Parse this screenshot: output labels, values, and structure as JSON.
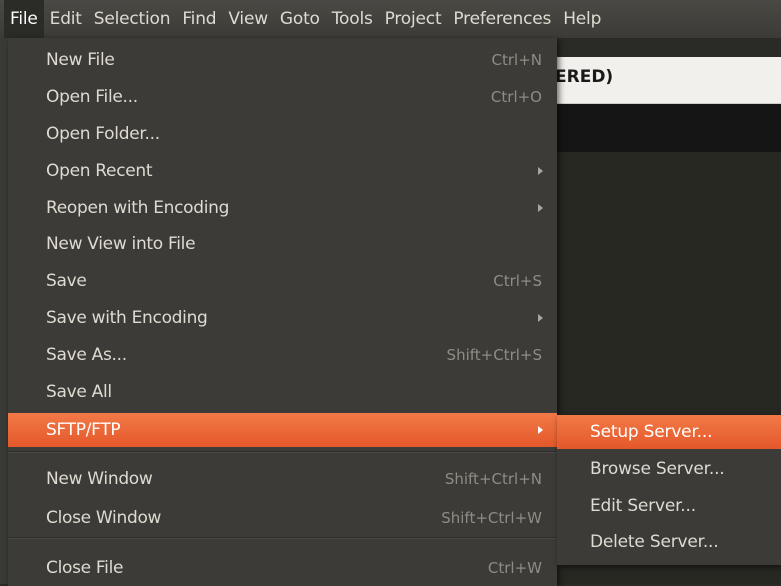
{
  "menubar": {
    "items": [
      "File",
      "Edit",
      "Selection",
      "Find",
      "View",
      "Goto",
      "Tools",
      "Project",
      "Preferences",
      "Help"
    ],
    "active": "File"
  },
  "background": {
    "header_fragment": "ERED)"
  },
  "file_menu": {
    "items": [
      {
        "label": "New File",
        "shortcut": "Ctrl+N"
      },
      {
        "label": "Open File...",
        "shortcut": "Ctrl+O"
      },
      {
        "label": "Open Folder...",
        "shortcut": ""
      },
      {
        "label": "Open Recent",
        "shortcut": "",
        "submenu": true
      },
      {
        "label": "Reopen with Encoding",
        "shortcut": "",
        "submenu": true
      },
      {
        "label": "New View into File",
        "shortcut": ""
      },
      {
        "label": "Save",
        "shortcut": "Ctrl+S"
      },
      {
        "label": "Save with Encoding",
        "shortcut": "",
        "submenu": true
      },
      {
        "label": "Save As...",
        "shortcut": "Shift+Ctrl+S"
      },
      {
        "label": "Save All",
        "shortcut": ""
      },
      {
        "label": "SFTP/FTP",
        "shortcut": "",
        "submenu": true,
        "highlighted": true
      },
      {
        "label": "New Window",
        "shortcut": "Shift+Ctrl+N"
      },
      {
        "label": "Close Window",
        "shortcut": "Shift+Ctrl+W"
      },
      {
        "label": "Close File",
        "shortcut": "Ctrl+W"
      }
    ]
  },
  "sftp_submenu": {
    "items": [
      {
        "label": "Setup Server...",
        "highlighted": true
      },
      {
        "label": "Browse Server..."
      },
      {
        "label": "Edit Server..."
      },
      {
        "label": "Delete Server..."
      }
    ]
  },
  "colors": {
    "menu_bg": "#3c3b37",
    "highlight": "#e96a3a",
    "text": "#dfdbd2",
    "shortcut_text": "#8f8c84"
  }
}
